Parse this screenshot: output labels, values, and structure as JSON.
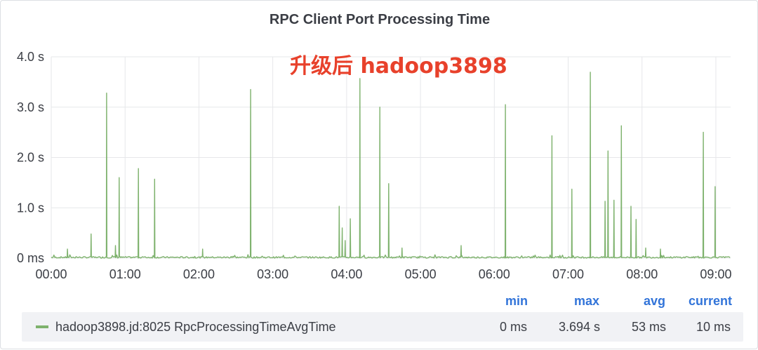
{
  "panel": {
    "title": "RPC Client Port Processing Time",
    "annotation": "升级后 hadoop3898"
  },
  "colors": {
    "series": "#7eb26d",
    "legend_header": "#3274d9",
    "annotation": "#e8412b",
    "grid": "#e6e7ea"
  },
  "legend": {
    "headers": {
      "min": "min",
      "max": "max",
      "avg": "avg",
      "current": "current"
    },
    "series": {
      "name": "hadoop3898.jd:8025 RpcProcessingTimeAvgTime",
      "min": "0 ms",
      "max": "3.694 s",
      "avg": "53 ms",
      "current": "10 ms"
    }
  },
  "chart_data": {
    "type": "line",
    "title": "RPC Client Port Processing Time",
    "xlabel": "",
    "ylabel": "",
    "x_unit": "hours",
    "xlim": [
      0,
      9.2
    ],
    "ylim": [
      0,
      4
    ],
    "x_ticks": [
      "00:00",
      "01:00",
      "02:00",
      "03:00",
      "04:00",
      "05:00",
      "06:00",
      "07:00",
      "08:00",
      "09:00"
    ],
    "y_ticks": [
      "0 ms",
      "1.0 s",
      "2.0 s",
      "3.0 s",
      "4.0 s"
    ],
    "grid": true,
    "baseline_value_s": 0.03,
    "series": [
      {
        "name": "hadoop3898.jd:8025 RpcProcessingTimeAvgTime",
        "spikes": [
          {
            "x": 0.22,
            "y": 0.18
          },
          {
            "x": 0.54,
            "y": 0.48
          },
          {
            "x": 0.75,
            "y": 3.28
          },
          {
            "x": 0.87,
            "y": 0.25
          },
          {
            "x": 0.92,
            "y": 1.6
          },
          {
            "x": 1.18,
            "y": 1.78
          },
          {
            "x": 1.4,
            "y": 1.57
          },
          {
            "x": 2.05,
            "y": 0.18
          },
          {
            "x": 2.7,
            "y": 3.35
          },
          {
            "x": 3.9,
            "y": 1.03
          },
          {
            "x": 3.94,
            "y": 0.6
          },
          {
            "x": 3.98,
            "y": 0.35
          },
          {
            "x": 4.05,
            "y": 0.78
          },
          {
            "x": 4.18,
            "y": 3.57
          },
          {
            "x": 4.45,
            "y": 3.0
          },
          {
            "x": 4.57,
            "y": 1.48
          },
          {
            "x": 4.75,
            "y": 0.2
          },
          {
            "x": 5.55,
            "y": 0.25
          },
          {
            "x": 6.15,
            "y": 3.05
          },
          {
            "x": 6.78,
            "y": 2.43
          },
          {
            "x": 7.05,
            "y": 1.37
          },
          {
            "x": 7.3,
            "y": 3.694
          },
          {
            "x": 7.5,
            "y": 1.13
          },
          {
            "x": 7.54,
            "y": 2.13
          },
          {
            "x": 7.62,
            "y": 1.15
          },
          {
            "x": 7.72,
            "y": 2.63
          },
          {
            "x": 7.85,
            "y": 1.03
          },
          {
            "x": 7.92,
            "y": 0.77
          },
          {
            "x": 8.05,
            "y": 0.2
          },
          {
            "x": 8.25,
            "y": 0.18
          },
          {
            "x": 8.83,
            "y": 2.5
          },
          {
            "x": 8.99,
            "y": 1.42
          }
        ]
      }
    ]
  }
}
